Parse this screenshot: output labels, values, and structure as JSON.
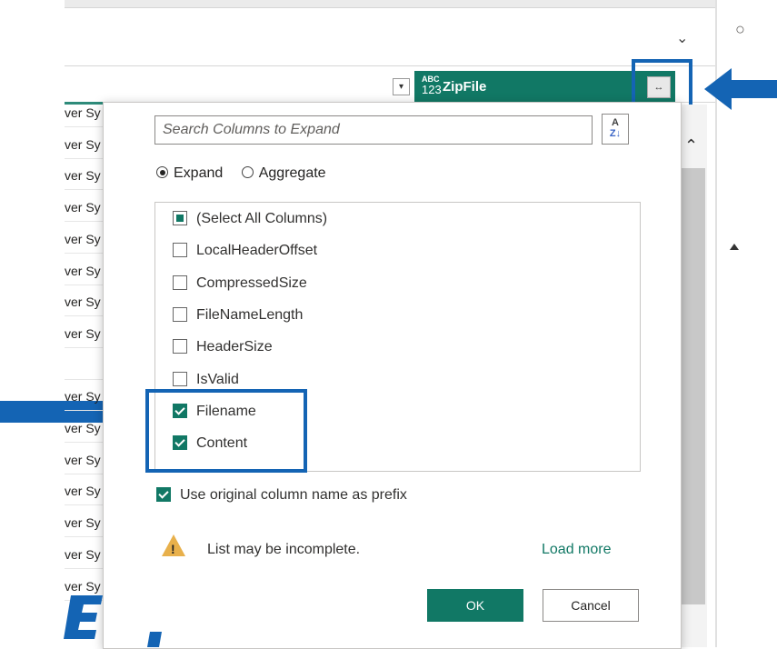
{
  "column_header": {
    "type_icon_top": "ABC",
    "type_icon_bottom": "123",
    "title": "ZipFile",
    "filter_glyph": "▾",
    "expand_glyph": "↔"
  },
  "left_rows": [
    "ver Sy",
    "ver Sy",
    "ver Sy",
    "ver Sy",
    "ver Sy",
    "ver Sy",
    "ver Sy",
    "ver Sy",
    "",
    "ver Sy",
    "ver Sy",
    "ver Sy",
    "ver Sy",
    "ver Sy",
    "ver Sy",
    "ver Sy"
  ],
  "dialog": {
    "search_placeholder": "Search Columns to Expand",
    "sort_glyph_a": "A",
    "sort_glyph_z": "Z↓",
    "mode_expand": "Expand",
    "mode_aggregate": "Aggregate",
    "selected_mode": "Expand",
    "columns": [
      {
        "label": "(Select All Columns)",
        "state": "partial"
      },
      {
        "label": "LocalHeaderOffset",
        "state": "unchecked"
      },
      {
        "label": "CompressedSize",
        "state": "unchecked"
      },
      {
        "label": "FileNameLength",
        "state": "unchecked"
      },
      {
        "label": "HeaderSize",
        "state": "unchecked"
      },
      {
        "label": "IsValid",
        "state": "unchecked"
      },
      {
        "label": "Filename",
        "state": "checked"
      },
      {
        "label": "Content",
        "state": "checked"
      }
    ],
    "prefix_label": "Use original column name as prefix",
    "prefix_checked": true,
    "warning_mark": "!",
    "warning_text": "List may be incomplete.",
    "load_more": "Load more",
    "ok_label": "OK",
    "cancel_label": "Cancel"
  },
  "colors": {
    "accent": "#117865",
    "highlight": "#1464b4",
    "warning": "#e8b04b"
  }
}
